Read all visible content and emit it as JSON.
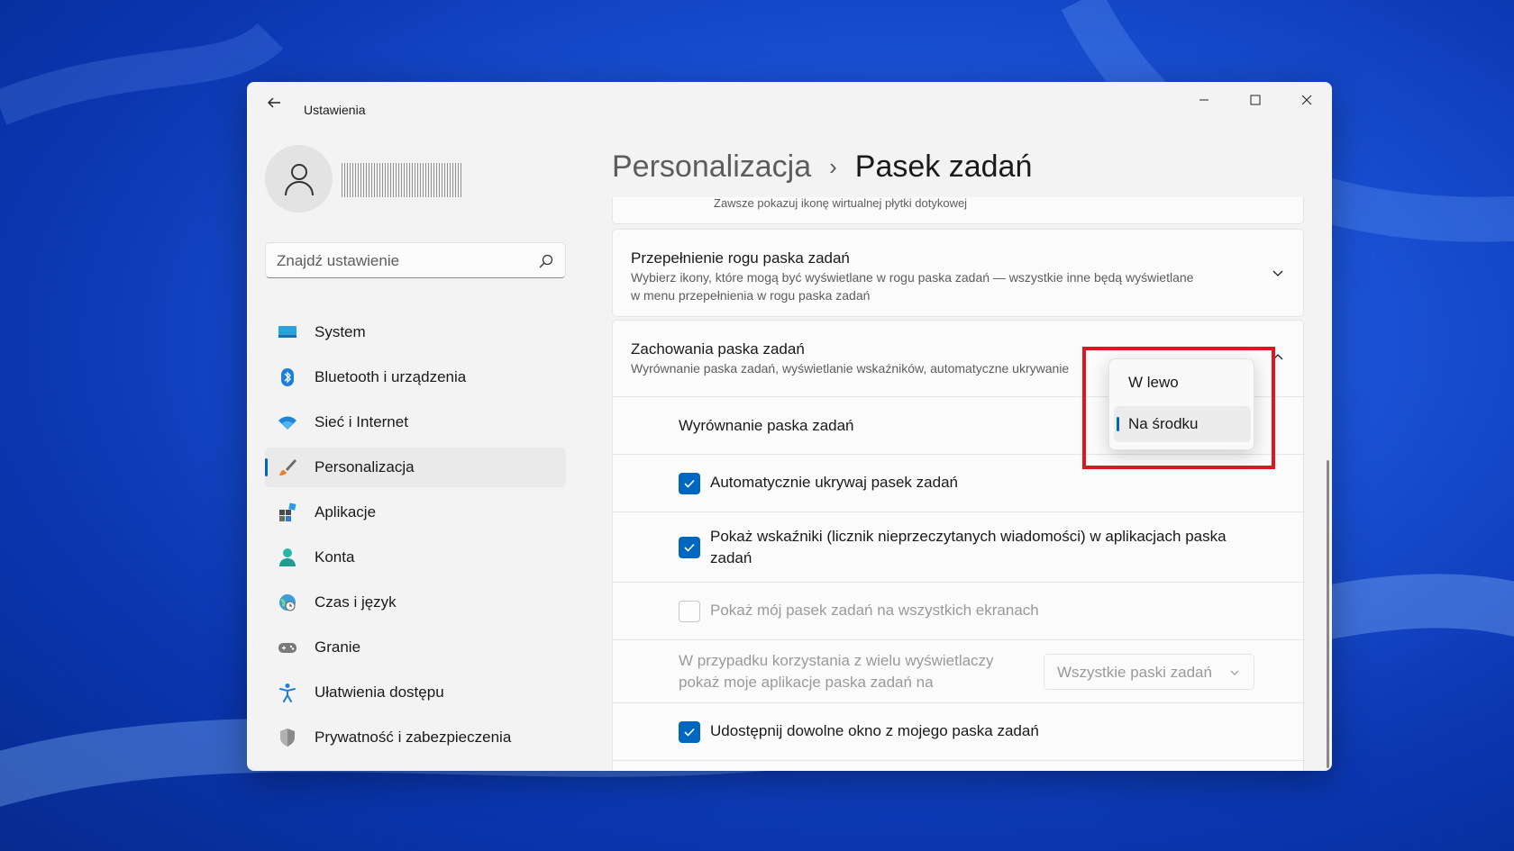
{
  "window": {
    "app_title": "Ustawienia"
  },
  "sidebar": {
    "search_placeholder": "Znajdź ustawienie",
    "items": [
      {
        "label": "System",
        "icon": "monitor-icon"
      },
      {
        "label": "Bluetooth i urządzenia",
        "icon": "bluetooth-icon"
      },
      {
        "label": "Sieć i Internet",
        "icon": "wifi-icon"
      },
      {
        "label": "Personalizacja",
        "icon": "brush-icon",
        "selected": true
      },
      {
        "label": "Aplikacje",
        "icon": "apps-icon"
      },
      {
        "label": "Konta",
        "icon": "person-icon"
      },
      {
        "label": "Czas i język",
        "icon": "globe-clock-icon"
      },
      {
        "label": "Granie",
        "icon": "gamepad-icon"
      },
      {
        "label": "Ułatwienia dostępu",
        "icon": "accessibility-icon"
      },
      {
        "label": "Prywatność i zabezpieczenia",
        "icon": "shield-icon"
      }
    ]
  },
  "breadcrumb": {
    "parent": "Personalizacja",
    "separator": "›",
    "current": "Pasek zadań"
  },
  "content": {
    "cut_card_text": "Zawsze pokazuj ikonę wirtualnej płytki dotykowej",
    "overflow_card": {
      "title": "Przepełnienie rogu paska zadań",
      "desc_line1": "Wybierz ikony, które mogą być wyświetlane w rogu paska zadań — wszystkie inne będą wyświetlane",
      "desc_line2": "w menu przepełnienia w rogu paska zadań"
    },
    "behaviors_card": {
      "title": "Zachowania paska zadań",
      "desc": "Wyrównanie paska zadań, wyświetlanie wskaźników, automatyczne ukrywanie",
      "alignment_label": "Wyrównanie paska zadań",
      "auto_hide_label": "Automatycznie ukrywaj pasek zadań",
      "auto_hide_checked": true,
      "badges_label_line1": "Pokaż wskaźniki (licznik nieprzeczytanych wiadomości) w aplikacjach paska",
      "badges_label_line2": "zadań",
      "badges_checked": true,
      "all_displays_label": "Pokaż mój pasek zadań na wszystkich ekranach",
      "all_displays_checked": false,
      "multi_display_line1": "W przypadku korzystania z wielu wyświetlaczy",
      "multi_display_line2": "pokaż moje aplikacje paska zadań na",
      "multi_display_value": "Wszystkie paski zadań",
      "share_window_label": "Udostępnij dowolne okno z mojego paska zadań",
      "share_window_checked": true
    }
  },
  "flyout": {
    "options": [
      "W lewo",
      "Na środku"
    ],
    "selected": "Na środku"
  },
  "colors": {
    "accent": "#0067c0",
    "highlight": "#e0151f"
  }
}
